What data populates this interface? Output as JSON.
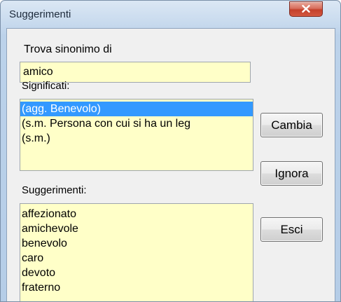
{
  "window": {
    "title": "Suggerimenti"
  },
  "find_synonym": {
    "label": "Trova sinonimo di",
    "value": "amico"
  },
  "meanings": {
    "label": "Significati:",
    "items": [
      "(agg. Benevolo)",
      "(s.m. Persona con cui si ha un leg",
      "(s.m.)"
    ],
    "selected_index": 0
  },
  "suggestions": {
    "label": "Suggerimenti:",
    "items": [
      "affezionato",
      "amichevole",
      "benevolo",
      "caro",
      "devoto",
      "fraterno"
    ]
  },
  "buttons": {
    "change": "Cambia",
    "ignore": "Ignora",
    "exit": "Esci"
  },
  "colors": {
    "field_background": "#ffffc8",
    "selection": "#3399ff"
  },
  "icons": {
    "close": "close-x-icon"
  }
}
